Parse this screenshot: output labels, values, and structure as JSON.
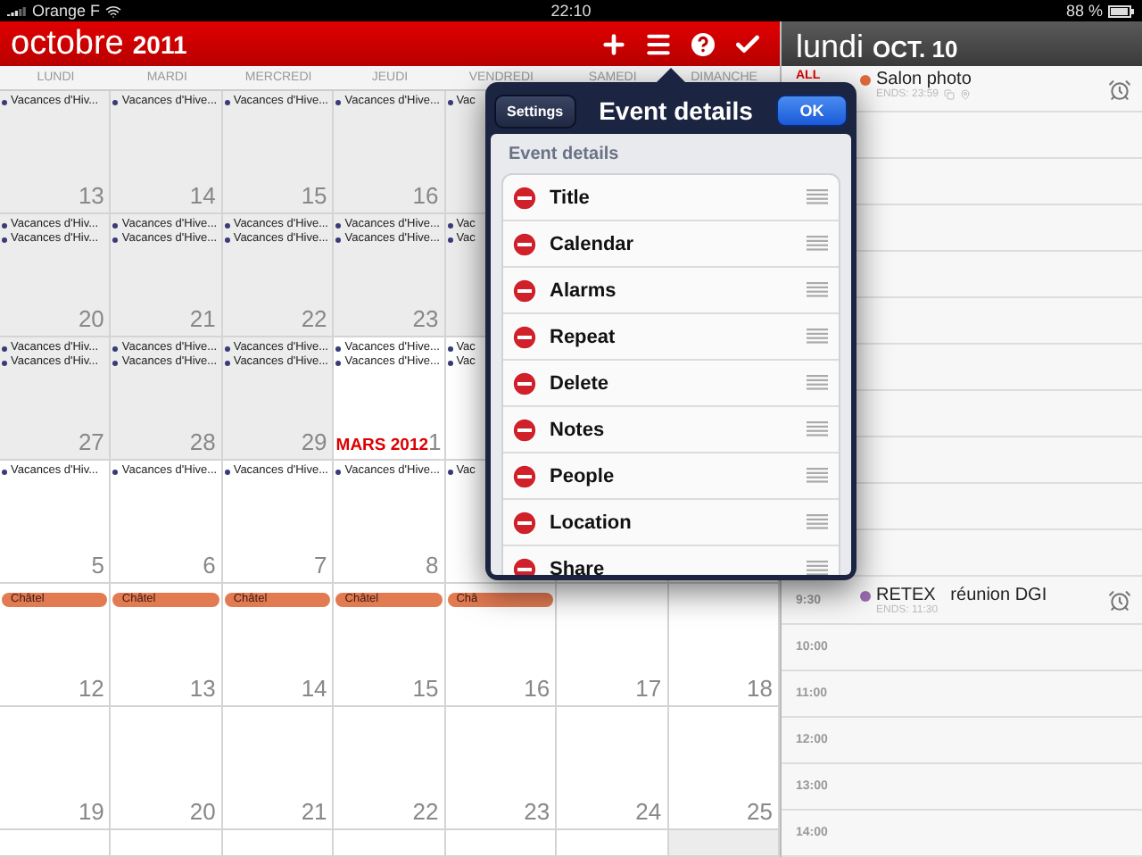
{
  "status_bar": {
    "carrier": "Orange F",
    "time": "22:10",
    "battery": "88 %"
  },
  "calendar": {
    "month": "octobre",
    "year": "2011",
    "weekdays": [
      "LUNDI",
      "MARDI",
      "MERCREDI",
      "JEUDI",
      "VENDREDI",
      "SAMEDI",
      "DIMANCHE"
    ],
    "weeks": [
      {
        "days": [
          {
            "day": "13",
            "shaded": true,
            "events": [
              {
                "kind": "dot",
                "text": "Vacances d'Hiv..."
              }
            ]
          },
          {
            "day": "14",
            "shaded": true,
            "events": [
              {
                "kind": "dot",
                "text": "Vacances d'Hive..."
              }
            ]
          },
          {
            "day": "15",
            "shaded": true,
            "events": [
              {
                "kind": "dot",
                "text": "Vacances d'Hive..."
              }
            ]
          },
          {
            "day": "16",
            "shaded": true,
            "events": [
              {
                "kind": "dot",
                "text": "Vacances d'Hive..."
              }
            ]
          },
          {
            "shaded": true,
            "events": [
              {
                "kind": "dot",
                "text": "Vac"
              }
            ]
          }
        ]
      },
      {
        "days": [
          {
            "day": "20",
            "shaded": true,
            "events": [
              {
                "kind": "dot",
                "text": "Vacances d'Hiv..."
              },
              {
                "kind": "dot",
                "text": "Vacances d'Hiv..."
              }
            ]
          },
          {
            "day": "21",
            "shaded": true,
            "events": [
              {
                "kind": "dot",
                "text": "Vacances d'Hive..."
              },
              {
                "kind": "dot",
                "text": "Vacances d'Hive..."
              }
            ]
          },
          {
            "day": "22",
            "shaded": true,
            "events": [
              {
                "kind": "dot",
                "text": "Vacances d'Hive..."
              },
              {
                "kind": "dot",
                "text": "Vacances d'Hive..."
              }
            ]
          },
          {
            "day": "23",
            "shaded": true,
            "events": [
              {
                "kind": "dot",
                "text": "Vacances d'Hive..."
              },
              {
                "kind": "dot",
                "text": "Vacances d'Hive..."
              }
            ]
          },
          {
            "shaded": true,
            "events": [
              {
                "kind": "dot",
                "text": "Vac"
              },
              {
                "kind": "dot",
                "text": "Vac"
              }
            ]
          }
        ]
      },
      {
        "days": [
          {
            "day": "27",
            "shaded": true,
            "events": [
              {
                "kind": "dot",
                "text": "Vacances d'Hiv..."
              },
              {
                "kind": "dot",
                "text": "Vacances d'Hiv..."
              }
            ]
          },
          {
            "day": "28",
            "shaded": true,
            "events": [
              {
                "kind": "dot",
                "text": "Vacances d'Hive..."
              },
              {
                "kind": "dot",
                "text": "Vacances d'Hive..."
              }
            ]
          },
          {
            "day": "29",
            "shaded": true,
            "events": [
              {
                "kind": "dot",
                "text": "Vacances d'Hive..."
              },
              {
                "kind": "dot",
                "text": "Vacances d'Hive..."
              }
            ]
          },
          {
            "day": "1",
            "month_label": "MARS 2012",
            "shaded": false,
            "events": [
              {
                "kind": "dot",
                "text": "Vacances d'Hive..."
              },
              {
                "kind": "dot",
                "text": "Vacances d'Hive..."
              }
            ]
          },
          {
            "shaded": false,
            "events": [
              {
                "kind": "dot",
                "text": "Vac"
              },
              {
                "kind": "dot",
                "text": "Vac"
              }
            ]
          }
        ]
      },
      {
        "days": [
          {
            "day": "5",
            "shaded": false,
            "events": [
              {
                "kind": "dot",
                "text": "Vacances d'Hiv..."
              }
            ]
          },
          {
            "day": "6",
            "shaded": false,
            "events": [
              {
                "kind": "dot",
                "text": "Vacances d'Hive..."
              }
            ]
          },
          {
            "day": "7",
            "shaded": false,
            "events": [
              {
                "kind": "dot",
                "text": "Vacances d'Hive..."
              }
            ]
          },
          {
            "day": "8",
            "shaded": false,
            "events": [
              {
                "kind": "dot",
                "text": "Vacances d'Hive..."
              }
            ]
          },
          {
            "shaded": false,
            "events": [
              {
                "kind": "dot",
                "text": "Vac"
              }
            ]
          }
        ]
      },
      {
        "days": [
          {
            "day": "12",
            "shaded": false,
            "events": [
              {
                "kind": "bar",
                "text": "Châtel"
              }
            ]
          },
          {
            "day": "13",
            "shaded": false,
            "events": [
              {
                "kind": "bar",
                "text": "Châtel"
              }
            ]
          },
          {
            "day": "14",
            "shaded": false,
            "events": [
              {
                "kind": "bar",
                "text": "Châtel"
              }
            ]
          },
          {
            "day": "15",
            "shaded": false,
            "events": [
              {
                "kind": "bar",
                "text": "Châtel"
              }
            ]
          },
          {
            "day": "16",
            "shaded": false,
            "events": [
              {
                "kind": "bar",
                "text": "Châ"
              }
            ]
          },
          {
            "day": "17",
            "shaded": false
          },
          {
            "day": "18",
            "shaded": false
          }
        ]
      },
      {
        "days": [
          {
            "day": "19",
            "shaded": false
          },
          {
            "day": "20",
            "shaded": false
          },
          {
            "day": "21",
            "shaded": false
          },
          {
            "day": "22",
            "shaded": false
          },
          {
            "day": "23",
            "shaded": false
          },
          {
            "day": "24",
            "shaded": false
          },
          {
            "day": "25",
            "shaded": false
          }
        ]
      },
      {
        "days": [
          {
            "shaded": false
          },
          {
            "shaded": false
          },
          {
            "shaded": false
          },
          {
            "shaded": false
          },
          {
            "shaded": false
          },
          {
            "shaded": false
          },
          {
            "shaded": true
          }
        ]
      }
    ]
  },
  "day_view": {
    "weekday": "lundi",
    "date": "OCT. 10",
    "all_day_label": "ALL",
    "all_day_event": {
      "title": "Salon photo",
      "ends": "ENDS: 23:59",
      "color": "#e06a3c"
    },
    "timed_event": {
      "time": "9:30",
      "title": "RETEX   réunion DGI",
      "ends": "ENDS: 11:30",
      "color": "#9b6bb0"
    },
    "hours": [
      "10:00",
      "11:00",
      "12:00",
      "13:00",
      "14:00"
    ]
  },
  "popover": {
    "back_button": "Settings",
    "title": "Event details",
    "ok_button": "OK",
    "section_header": "Event details",
    "items": [
      "Title",
      "Calendar",
      "Alarms",
      "Repeat",
      "Delete",
      "Notes",
      "People",
      "Location",
      "Share"
    ]
  }
}
